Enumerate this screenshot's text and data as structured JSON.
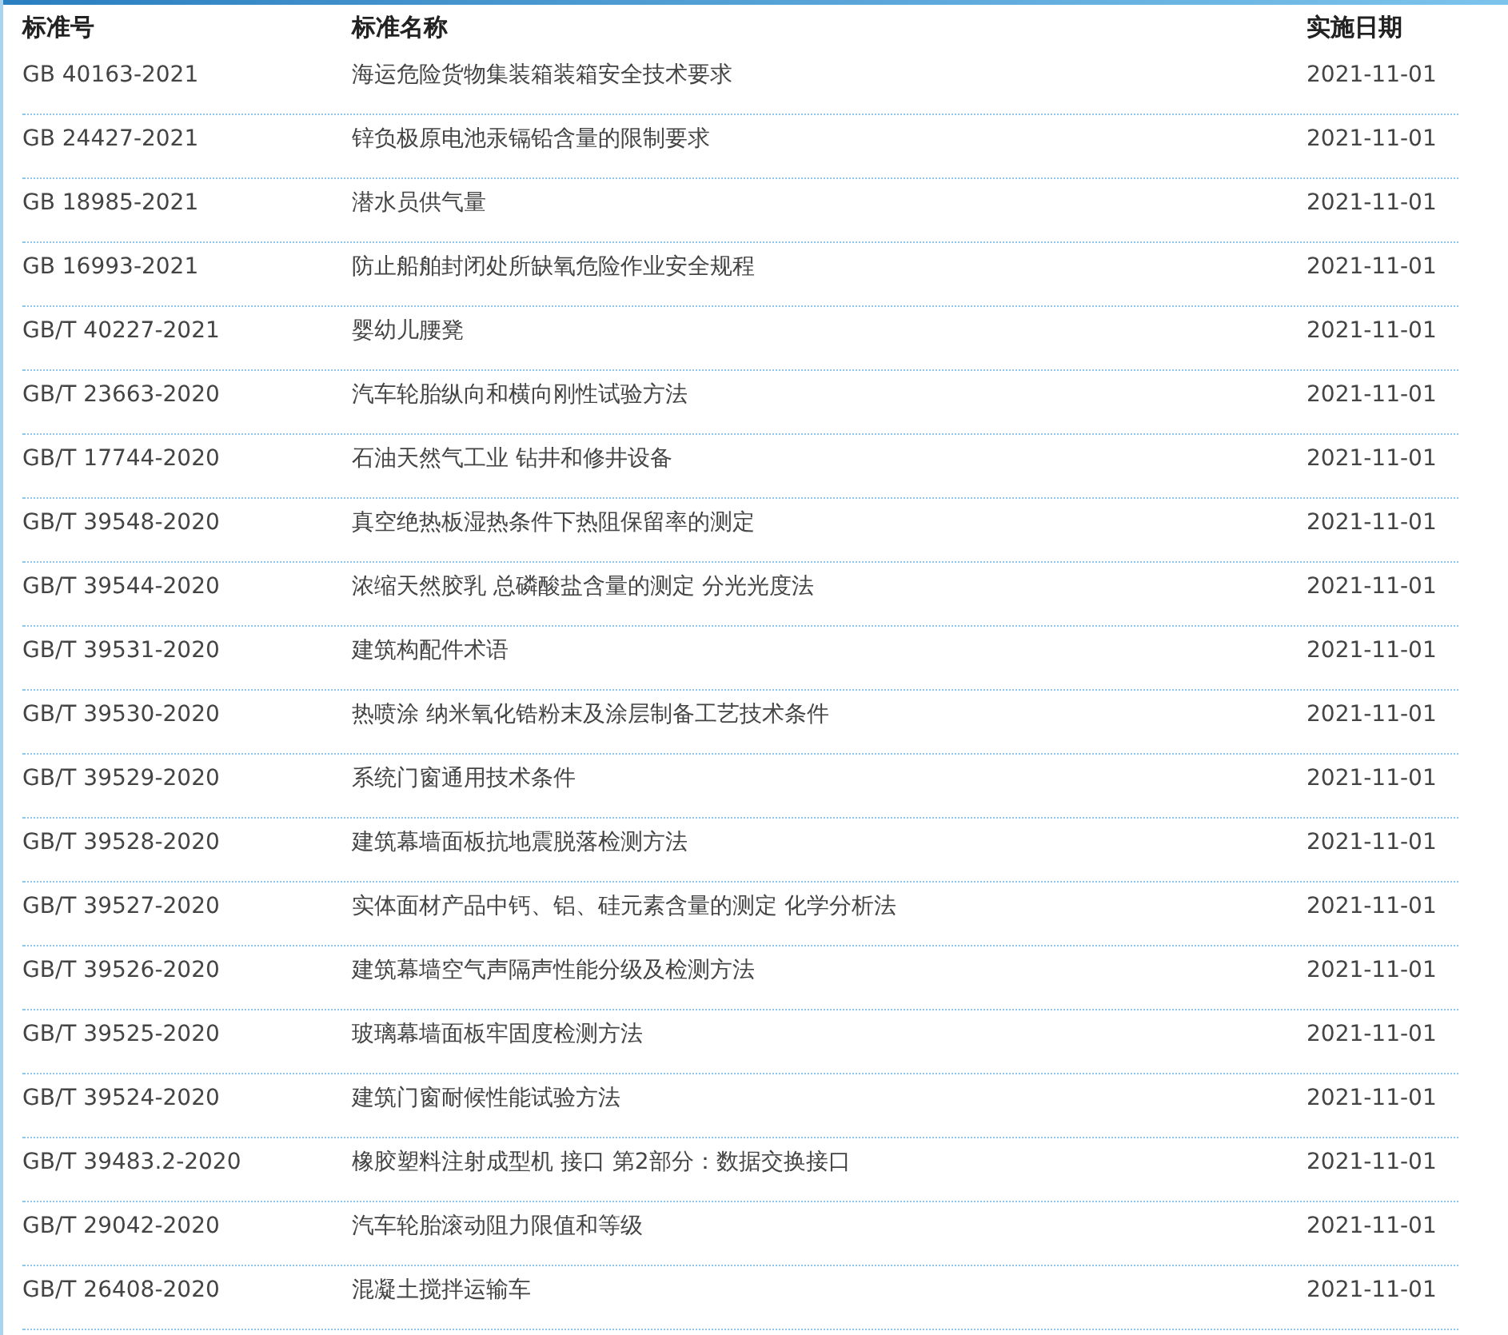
{
  "columns": [
    "标准号",
    "标准名称",
    "实施日期"
  ],
  "rows": [
    {
      "code": "GB 40163-2021",
      "name": "海运危险货物集装箱装箱安全技术要求",
      "date": "2021-11-01"
    },
    {
      "code": "GB 24427-2021",
      "name": "锌负极原电池汞镉铅含量的限制要求",
      "date": "2021-11-01"
    },
    {
      "code": "GB 18985-2021",
      "name": "潜水员供气量",
      "date": "2021-11-01"
    },
    {
      "code": "GB 16993-2021",
      "name": "防止船舶封闭处所缺氧危险作业安全规程",
      "date": "2021-11-01"
    },
    {
      "code": "GB/T 40227-2021",
      "name": "婴幼儿腰凳",
      "date": "2021-11-01"
    },
    {
      "code": "GB/T 23663-2020",
      "name": "汽车轮胎纵向和横向刚性试验方法",
      "date": "2021-11-01"
    },
    {
      "code": "GB/T 17744-2020",
      "name": "石油天然气工业 钻井和修井设备",
      "date": "2021-11-01"
    },
    {
      "code": "GB/T 39548-2020",
      "name": "真空绝热板湿热条件下热阻保留率的测定",
      "date": "2021-11-01"
    },
    {
      "code": "GB/T 39544-2020",
      "name": "浓缩天然胶乳 总磷酸盐含量的测定 分光光度法",
      "date": "2021-11-01"
    },
    {
      "code": "GB/T 39531-2020",
      "name": "建筑构配件术语",
      "date": "2021-11-01"
    },
    {
      "code": "GB/T 39530-2020",
      "name": "热喷涂 纳米氧化锆粉末及涂层制备工艺技术条件",
      "date": "2021-11-01"
    },
    {
      "code": "GB/T 39529-2020",
      "name": "系统门窗通用技术条件",
      "date": "2021-11-01"
    },
    {
      "code": "GB/T 39528-2020",
      "name": "建筑幕墙面板抗地震脱落检测方法",
      "date": "2021-11-01"
    },
    {
      "code": "GB/T 39527-2020",
      "name": "实体面材产品中钙、铝、硅元素含量的测定 化学分析法",
      "date": "2021-11-01"
    },
    {
      "code": "GB/T 39526-2020",
      "name": "建筑幕墙空气声隔声性能分级及检测方法",
      "date": "2021-11-01"
    },
    {
      "code": "GB/T 39525-2020",
      "name": "玻璃幕墙面板牢固度检测方法",
      "date": "2021-11-01"
    },
    {
      "code": "GB/T 39524-2020",
      "name": "建筑门窗耐候性能试验方法",
      "date": "2021-11-01"
    },
    {
      "code": "GB/T 39483.2-2020",
      "name": "橡胶塑料注射成型机 接口 第2部分：数据交换接口",
      "date": "2021-11-01"
    },
    {
      "code": "GB/T 29042-2020",
      "name": "汽车轮胎滚动阻力限值和等级",
      "date": "2021-11-01"
    },
    {
      "code": "GB/T 26408-2020",
      "name": "混凝土搅拌运输车",
      "date": "2021-11-01"
    }
  ]
}
